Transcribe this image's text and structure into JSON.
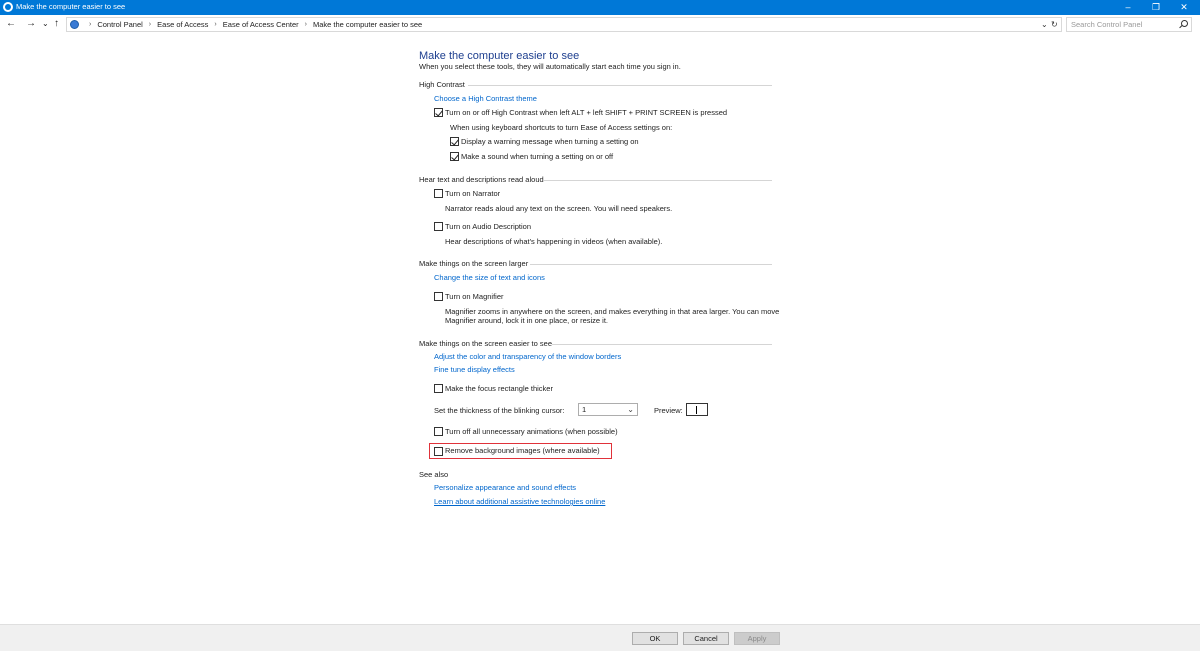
{
  "window": {
    "title": "Make the computer easier to see",
    "minimize_glyph": "–",
    "restore_glyph": "❐",
    "close_glyph": "✕"
  },
  "nav": {
    "back_glyph": "←",
    "forward_glyph": "→",
    "recent_glyph": "⌄",
    "up_glyph": "↑",
    "dropdown_glyph": "⌄",
    "refresh_glyph": "↻"
  },
  "breadcrumbs": [
    "Control Panel",
    "Ease of Access",
    "Ease of Access Center",
    "Make the computer easier to see"
  ],
  "breadcrumb_separator": "›",
  "search": {
    "placeholder": "Search Control Panel"
  },
  "page": {
    "title": "Make the computer easier to see",
    "subtitle": "When you select these tools, they will automatically start each time you sign in."
  },
  "high_contrast": {
    "heading": "High Contrast",
    "choose_theme_link": "Choose a High Contrast theme",
    "toggle_label": "Turn on or off High Contrast when left ALT + left SHIFT + PRINT SCREEN is pressed",
    "toggle_checked": true,
    "shortcut_note": "When using keyboard shortcuts to turn Ease of Access settings on:",
    "warning_label": "Display a warning message when turning a setting on",
    "warning_checked": true,
    "sound_label": "Make a sound when turning a setting on or off",
    "sound_checked": true
  },
  "hear_text": {
    "heading": "Hear text and descriptions read aloud",
    "narrator_label": "Turn on Narrator",
    "narrator_checked": false,
    "narrator_desc": "Narrator reads aloud any text on the screen. You will need speakers.",
    "audio_desc_label": "Turn on Audio Description",
    "audio_desc_checked": false,
    "audio_desc_desc": "Hear descriptions of what's happening in videos (when available)."
  },
  "larger": {
    "heading": "Make things on the screen larger",
    "change_size_link": "Change the size of text and icons",
    "magnifier_label": "Turn on Magnifier",
    "magnifier_checked": false,
    "magnifier_desc_1": "Magnifier zooms in anywhere on the screen, and makes everything in that area larger. You can move",
    "magnifier_desc_2": "Magnifier around, lock it in one place, or resize it."
  },
  "easier": {
    "heading": "Make things on the screen easier to see",
    "adjust_color_link": "Adjust the color and transparency of the window borders",
    "fine_tune_link": "Fine tune display effects",
    "focus_label": "Make the focus rectangle thicker",
    "focus_checked": false,
    "cursor_label": "Set the thickness of the blinking cursor:",
    "cursor_value": "1",
    "preview_label": "Preview:",
    "animations_label": "Turn off all unnecessary animations (when possible)",
    "animations_checked": false,
    "bg_images_label": "Remove background images (where available)",
    "bg_images_checked": false
  },
  "see_also": {
    "heading": "See also",
    "personalize_link": "Personalize appearance and sound effects",
    "learn_link": "Learn about additional assistive technologies online"
  },
  "buttons": {
    "ok": "OK",
    "cancel": "Cancel",
    "apply": "Apply"
  },
  "colors": {
    "titlebar": "#0078d7",
    "link": "#0066cc",
    "page_title": "#1e3f8f",
    "highlight": "#e0323a"
  }
}
